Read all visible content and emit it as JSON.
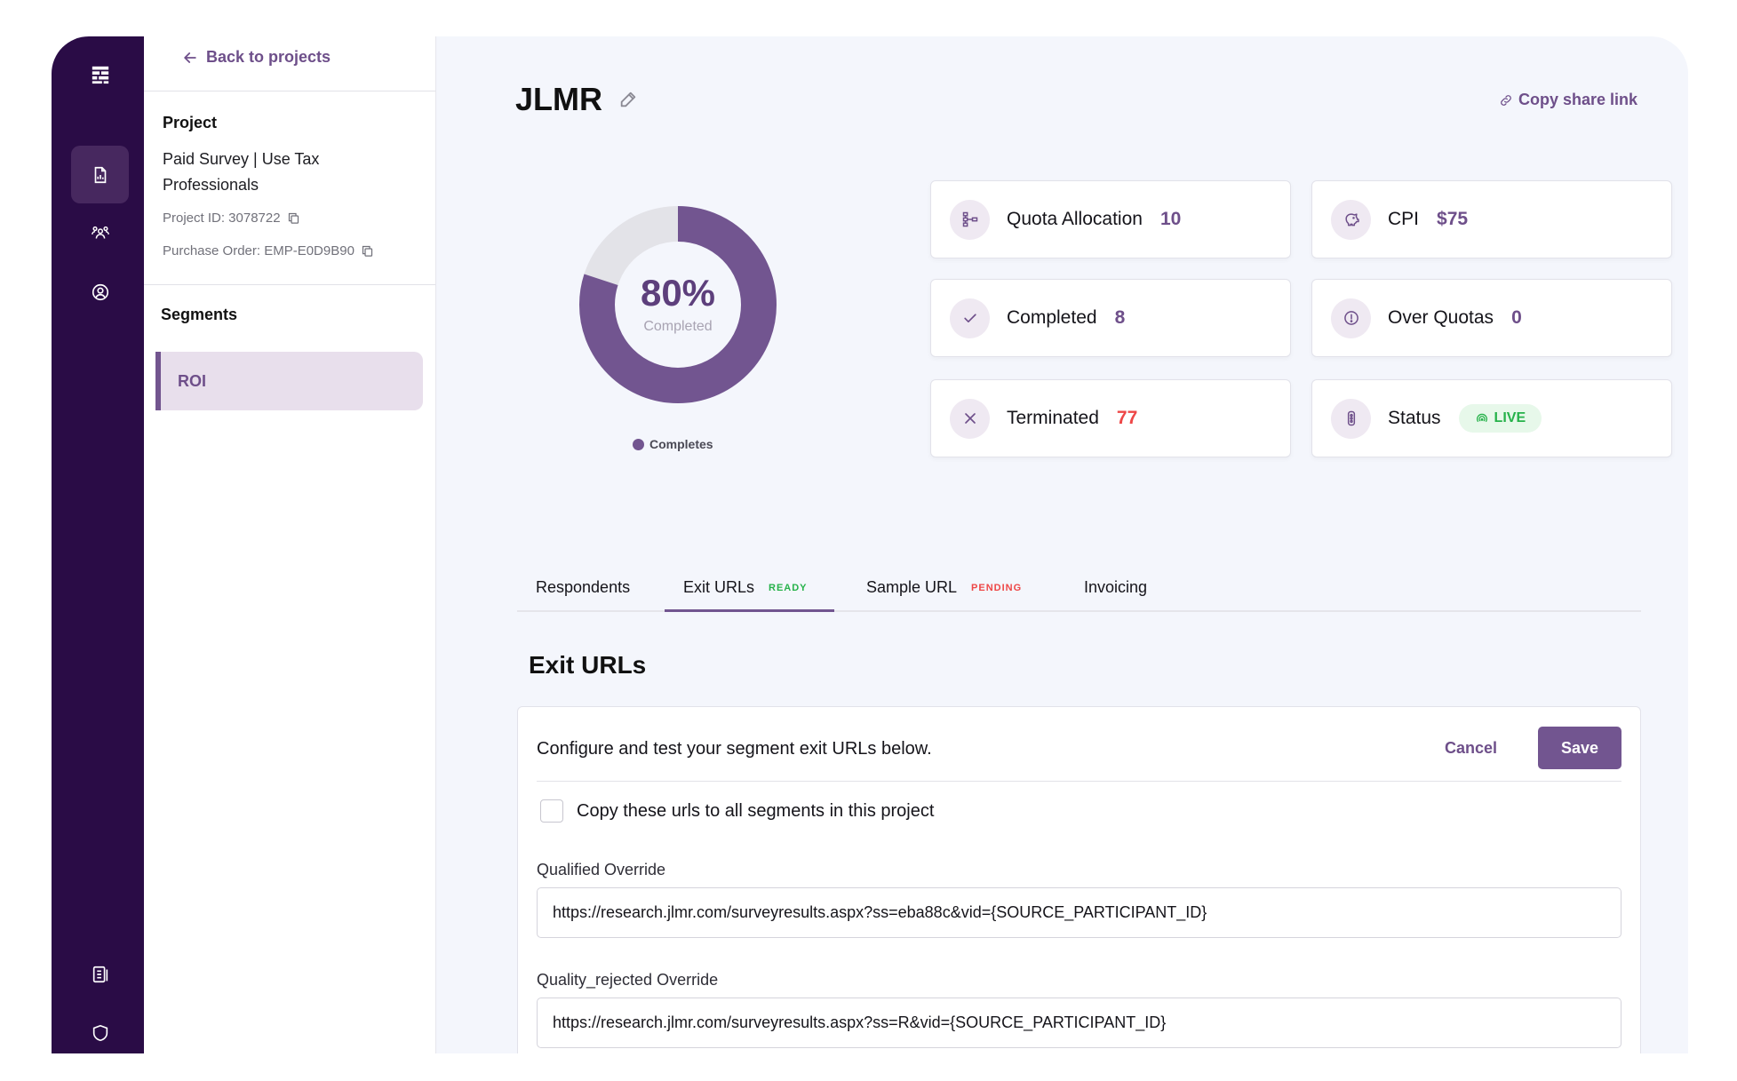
{
  "sidebar": {
    "back_label": "Back to projects",
    "project_heading": "Project",
    "project_name": "Paid Survey | Use Tax Professionals",
    "project_id": "Project ID: 3078722",
    "purchase_order": "Purchase Order: EMP-E0D9B90",
    "segments_heading": "Segments",
    "segments": [
      {
        "label": "ROI"
      }
    ]
  },
  "header": {
    "title": "JLMR",
    "share_label": "Copy share link"
  },
  "progress": {
    "percent": 80,
    "percent_label": "80%",
    "sub_label": "Completed",
    "legend": "Completes",
    "colors": {
      "fill": "#725590",
      "track": "#e3e3e8"
    }
  },
  "stats": {
    "quota": {
      "label": "Quota Allocation",
      "value": "10"
    },
    "cpi": {
      "label": "CPI",
      "value": "$75"
    },
    "completed": {
      "label": "Completed",
      "value": "8"
    },
    "over": {
      "label": "Over Quotas",
      "value": "0"
    },
    "terminated": {
      "label": "Terminated",
      "value": "77"
    },
    "status": {
      "label": "Status",
      "value": "LIVE"
    }
  },
  "tabs": [
    {
      "label": "Respondents",
      "badge": ""
    },
    {
      "label": "Exit URLs",
      "badge": "READY"
    },
    {
      "label": "Sample URL",
      "badge": "PENDING"
    },
    {
      "label": "Invoicing",
      "badge": ""
    }
  ],
  "exit_urls": {
    "heading": "Exit URLs",
    "description": "Configure and test your segment exit URLs below.",
    "cancel_label": "Cancel",
    "save_label": "Save",
    "copy_checkbox_label": "Copy these urls to all segments in this project",
    "fields": [
      {
        "label": "Qualified Override",
        "value": "https://research.jlmr.com/surveyresults.aspx?ss=eba88c&vid={SOURCE_PARTICIPANT_ID}"
      },
      {
        "label": "Quality_rejected Override",
        "value": "https://research.jlmr.com/surveyresults.aspx?ss=R&vid={SOURCE_PARTICIPANT_ID}"
      }
    ]
  },
  "colors": {
    "brand": "#725590",
    "rail": "#2a0c46",
    "ready": "#26b24a",
    "pending": "#ee4747"
  }
}
